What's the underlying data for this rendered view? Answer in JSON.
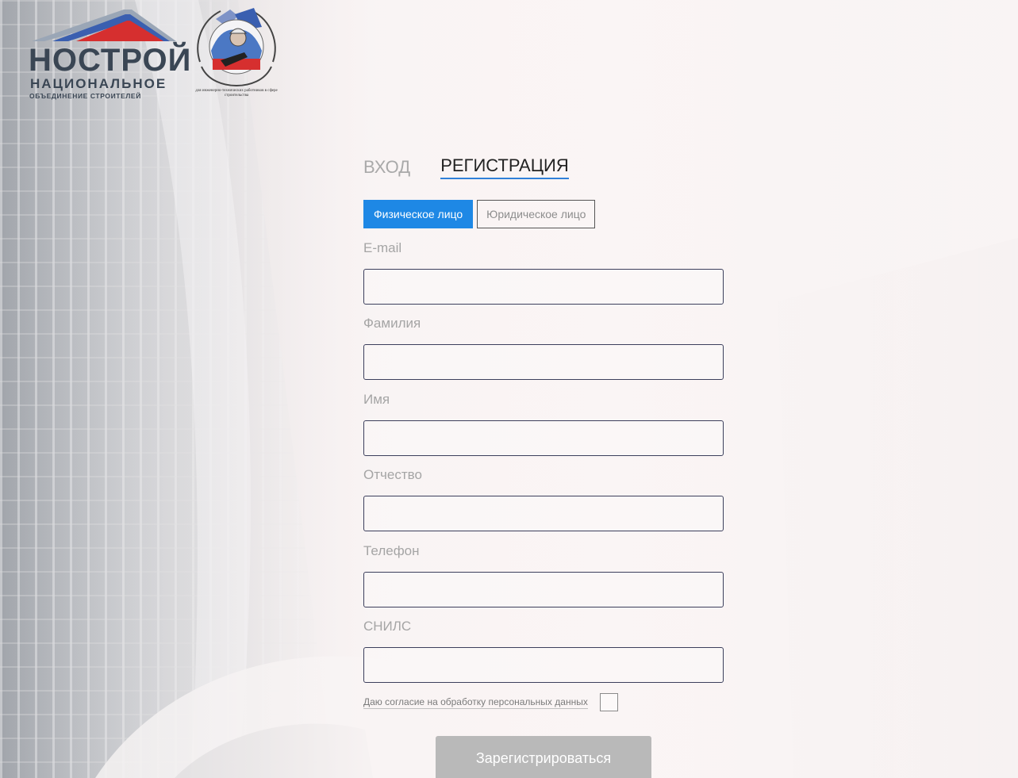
{
  "logo": {
    "main": "НОСТРОЙ",
    "line1": "НАЦИОНАЛЬНОЕ",
    "line2": "ОБЪЕДИНЕНИЕ СТРОИТЕЛЕЙ",
    "emblem_caption": "для инженерно-технических работников в сфере строительства"
  },
  "tabs": {
    "login": "ВХОД",
    "register": "РЕГИСТРАЦИЯ"
  },
  "person_type": {
    "individual": "Физическое лицо",
    "legal": "Юридическое лицо",
    "selected": "Физическое лицо"
  },
  "form": {
    "email_label": "E-mail",
    "surname_label": "Фамилия",
    "name_label": "Имя",
    "patronymic_label": "Отчество",
    "phone_label": "Телефон",
    "snils_label": "СНИЛС",
    "consent_text": "Даю согласие на обработку персональных данных",
    "consent_checked": false,
    "submit_label": "Зарегистрироваться"
  },
  "colors": {
    "accent": "#1e88e5",
    "logo_text": "#3a4654",
    "submit_bg": "#b9b9b9"
  }
}
